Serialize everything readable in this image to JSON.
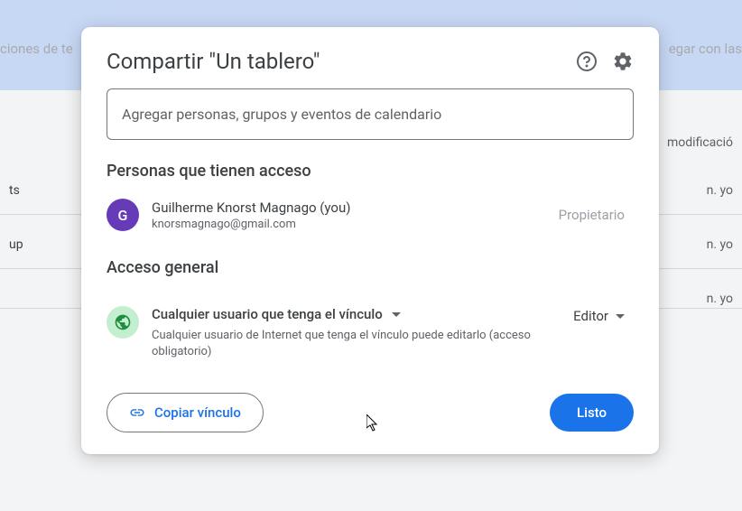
{
  "background": {
    "header_partial": "ciones de te",
    "header_right": "egar con las",
    "col_header": "modificació",
    "rows": [
      {
        "left": "ts",
        "right": "n. yo"
      },
      {
        "left": "up",
        "right": "n. yo"
      },
      {
        "left": "",
        "right": "n. yo"
      }
    ]
  },
  "dialog": {
    "title": "Compartir \"Un tablero\"",
    "input_placeholder": "Agregar personas, grupos y eventos de calendario",
    "people_section_title": "Personas que tienen acceso",
    "owner": {
      "initial": "G",
      "name": "Guilherme Knorst Magnago (you)",
      "email": "knorsmagnago@gmail.com",
      "role": "Propietario"
    },
    "general_access_title": "Acceso general",
    "access": {
      "scope": "Cualquier usuario que tenga el vínculo",
      "description": "Cualquier usuario de Internet que tenga el vínculo puede editarlo (acceso obligatorio)",
      "permission": "Editor"
    },
    "copy_link": "Copiar vínculo",
    "done": "Listo"
  }
}
